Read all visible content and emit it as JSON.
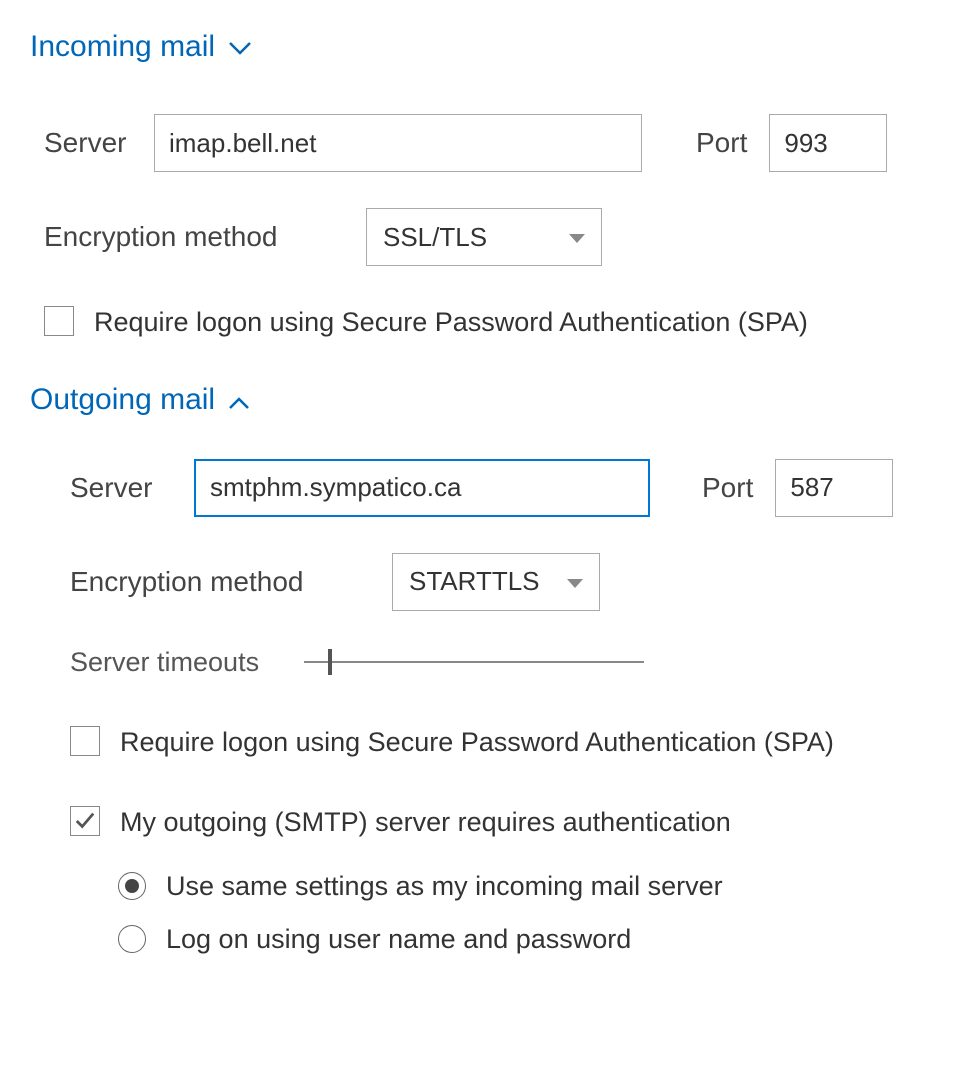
{
  "incoming": {
    "header": "Incoming mail",
    "server_label": "Server",
    "server_value": "imap.bell.net",
    "port_label": "Port",
    "port_value": "993",
    "encryption_label": "Encryption method",
    "encryption_value": "SSL/TLS",
    "spa_label": "Require logon using Secure Password Authentication (SPA)",
    "spa_checked": false
  },
  "outgoing": {
    "header": "Outgoing mail",
    "server_label": "Server",
    "server_value": "smtphm.sympatico.ca",
    "port_label": "Port",
    "port_value": "587",
    "encryption_label": "Encryption method",
    "encryption_value": "STARTTLS",
    "timeouts_label": "Server timeouts",
    "spa_label": "Require logon using Secure Password Authentication (SPA)",
    "spa_checked": false,
    "auth_label": "My outgoing (SMTP) server requires authentication",
    "auth_checked": true,
    "radio_same": "Use same settings as my incoming mail server",
    "radio_logon": "Log on using user name and password",
    "radio_selected": "same"
  }
}
